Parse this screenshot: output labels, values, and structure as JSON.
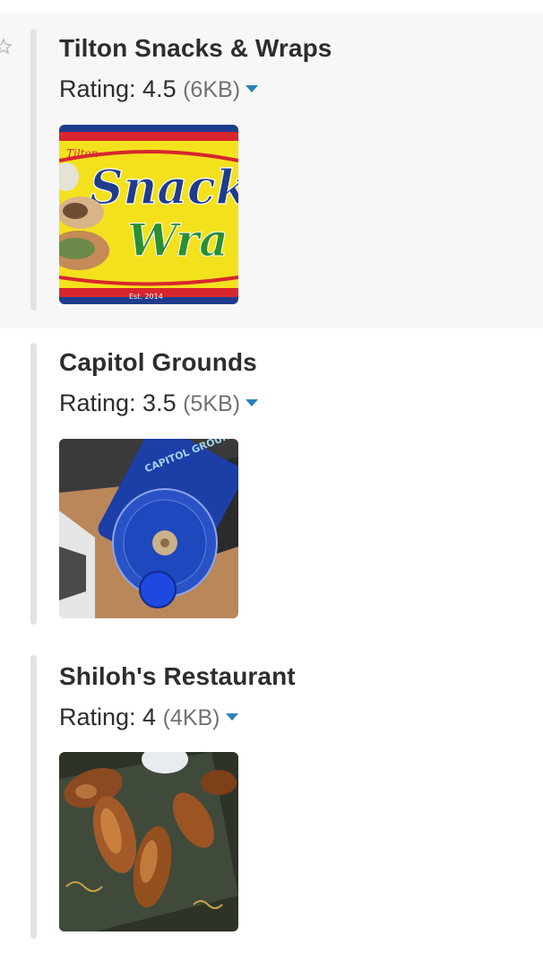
{
  "messages": [
    {
      "title": "Tilton Snacks & Wraps",
      "rating_label": "Rating: 4.5",
      "file_size": "(6KB)",
      "image": {
        "alt": "Tilton Snacks & Wraps logo",
        "logo_small_text": "Tilton",
        "logo_word_1": "Snack",
        "logo_word_2": "Wra",
        "logo_est": "Est. 2014"
      }
    },
    {
      "title": "Capitol Grounds",
      "rating_label": "Rating: 3.5",
      "file_size": "(5KB)",
      "image": {
        "alt": "Capitol Grounds blue coffee cup",
        "cup_text": "CAPITOL GROUNDS"
      }
    },
    {
      "title": "Shiloh's Restaurant",
      "rating_label": "Rating: 4",
      "file_size": "(4KB)",
      "image": {
        "alt": "Plate of chicken wings"
      }
    }
  ],
  "icons": {
    "star": "star-outline-icon",
    "caret": "caret-down-icon"
  },
  "colors": {
    "caret": "#2a80b9",
    "highlight_bg": "#f7f7f7",
    "bar": "#e3e3e3"
  }
}
